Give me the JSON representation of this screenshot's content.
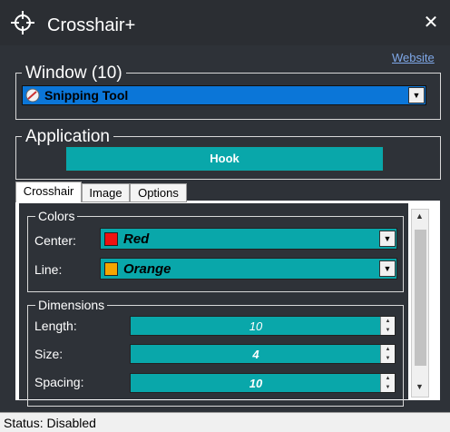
{
  "titlebar": {
    "title": "Crosshair+",
    "close_symbol": "✕"
  },
  "header": {
    "website_link": "Website"
  },
  "window_group": {
    "label": "Window (10)",
    "selected": "Snipping Tool"
  },
  "application_group": {
    "label": "Application",
    "hook_button": "Hook"
  },
  "tabs": [
    {
      "label": "Crosshair",
      "active": true
    },
    {
      "label": "Image",
      "active": false
    },
    {
      "label": "Options",
      "active": false
    }
  ],
  "colors": {
    "label": "Colors",
    "center": {
      "label": "Center:",
      "value": "Red",
      "swatch": "#ee1111"
    },
    "line": {
      "label": "Line:",
      "value": "Orange",
      "swatch": "#f5a500"
    }
  },
  "dimensions": {
    "label": "Dimensions",
    "length": {
      "label": "Length:",
      "value": "10"
    },
    "size": {
      "label": "Size:",
      "value": "4"
    },
    "spacing": {
      "label": "Spacing:",
      "value": "10"
    }
  },
  "status": {
    "text": "Status: Disabled"
  },
  "theme": {
    "accent": "#09a7aa",
    "selection": "#0b76d8",
    "background": "#2e3238"
  }
}
